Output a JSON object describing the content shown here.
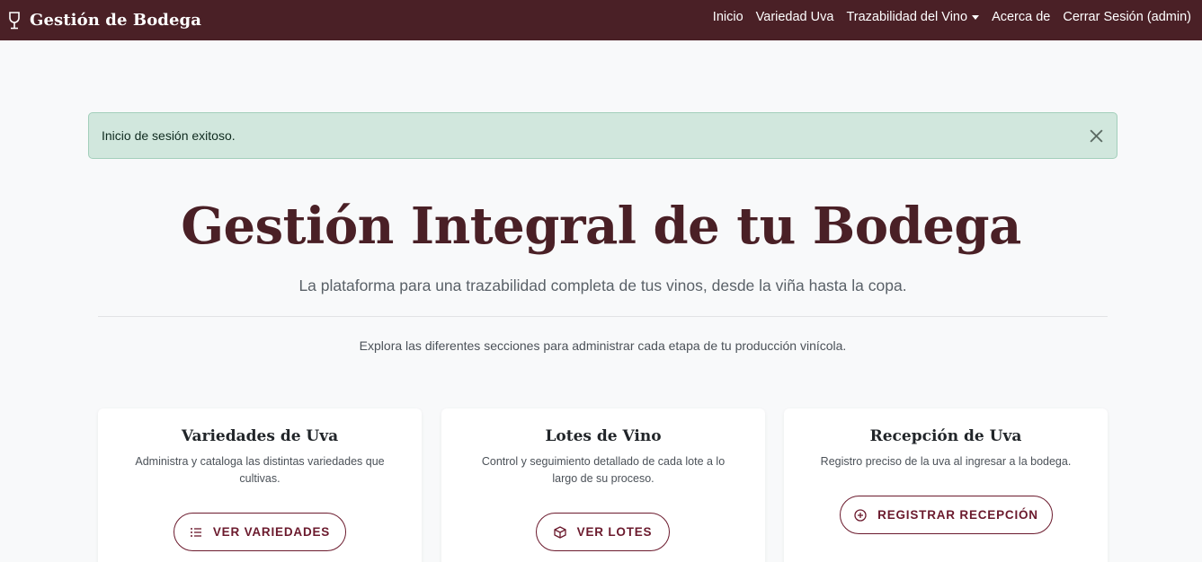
{
  "navbar": {
    "brand": "Gestión de Bodega",
    "brand_icon": "wine-glass-icon",
    "links": [
      "Inicio",
      "Variedad Uva",
      "Trazabilidad del Vino",
      "Acerca de",
      "Cerrar Sesión (admin)"
    ]
  },
  "alert": {
    "message": "Inicio de sesión exitoso.",
    "close_icon": "close-icon"
  },
  "hero": {
    "title": "Gestión Integral de tu Bodega",
    "subtitle": "La plataforma para una trazabilidad completa de tus vinos, desde la viña hasta la copa.",
    "explore": "Explora las diferentes secciones para administrar cada etapa de tu producción vinícola."
  },
  "cards": [
    {
      "title": "Variedades de Uva",
      "description": "Administra y cataloga las distintas variedades que cultivas.",
      "button": "VER VARIEDADES",
      "icon": "list-icon"
    },
    {
      "title": "Lotes de Vino",
      "description": "Control y seguimiento detallado de cada lote a lo largo de su proceso.",
      "button": "VER LOTES",
      "icon": "box-icon"
    },
    {
      "title": "Recepción de Uva",
      "description": "Registro preciso de la uva al ingresar a la bodega.",
      "button": "REGISTRAR RECEPCIÓN",
      "icon": "plus-circle-icon"
    }
  ],
  "colors": {
    "navbar": "#4a2026",
    "accent": "#6b1a2d",
    "alert_bg": "#d1e7dd"
  }
}
